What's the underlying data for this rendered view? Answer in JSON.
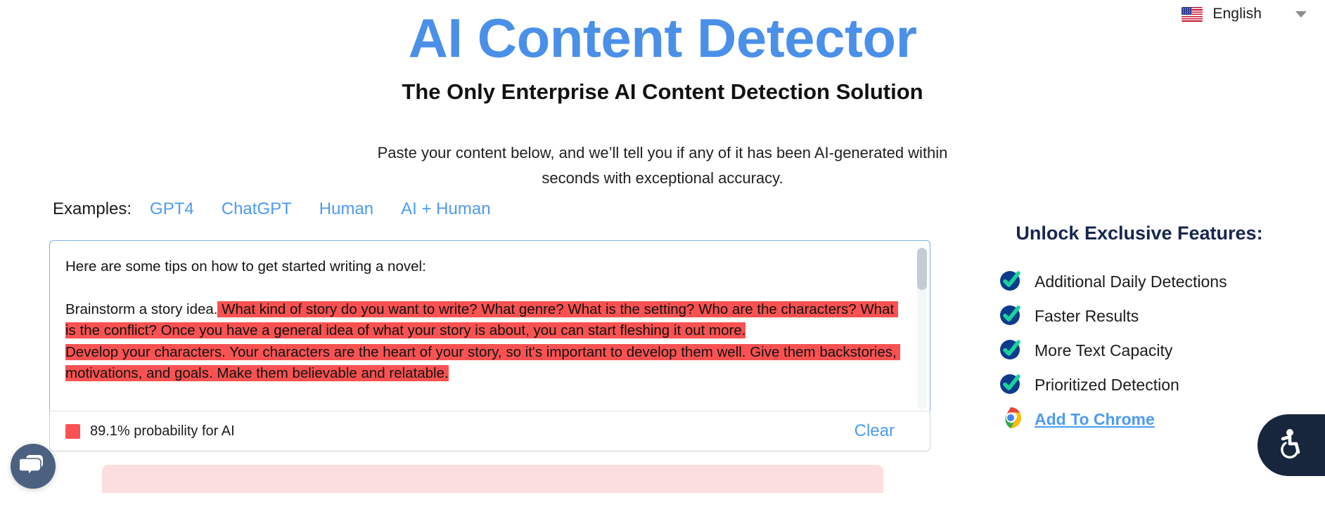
{
  "language_selector": {
    "flag_icon": "us-flag-icon",
    "label": "English",
    "caret_icon": "chevron-down-icon"
  },
  "hero": {
    "title": "AI Content Detector",
    "subtitle": "The Only Enterprise AI Content Detection Solution",
    "description": "Paste your content below, and we’ll tell you if any of it has been AI-generated within seconds with exceptional accuracy.",
    "title_color": "#4a90e8"
  },
  "examples": {
    "label": "Examples:",
    "items": [
      {
        "label": "GPT4"
      },
      {
        "label": "ChatGPT"
      },
      {
        "label": "Human"
      },
      {
        "label": "AI + Human"
      }
    ],
    "link_color": "#4e9af1"
  },
  "editor": {
    "intro_line": "Here are some tips on how to get started writing a novel:",
    "line2_plain": "Brainstorm a story idea.",
    "line2_highlight": " What kind of story do you want to write? What genre? What is the setting? Who are the characters? What is the conflict? Once you have a general idea of what your story is about, you can start fleshing it out more.",
    "line3_highlight": "Develop your characters. Your characters are the heart of your story, so it's important to develop them well. Give them backstories, motivations, and goals. Make them believable and relatable.",
    "highlight_color": "#fa5252"
  },
  "result": {
    "swatch_color": "#fa5252",
    "probability_text": "89.1% probability for AI",
    "clear_label": "Clear"
  },
  "sidebar": {
    "heading": "Unlock Exclusive Features:",
    "features": [
      {
        "icon": "check-circle-icon",
        "label": "Additional Daily Detections",
        "is_link": false
      },
      {
        "icon": "check-circle-icon",
        "label": "Faster Results",
        "is_link": false
      },
      {
        "icon": "check-circle-icon",
        "label": "More Text Capacity",
        "is_link": false
      },
      {
        "icon": "check-circle-icon",
        "label": "Prioritized Detection",
        "is_link": false
      },
      {
        "icon": "chrome-icon",
        "label": "Add To Chrome",
        "is_link": true
      }
    ],
    "check_circle_color": "#0b3b8c",
    "check_mark_color": "#19d39a",
    "heading_color": "#17264f"
  },
  "widgets": {
    "chat": {
      "icon": "chat-bubble-icon",
      "color": "#4c6180"
    },
    "accessibility": {
      "icon": "wheelchair-accessibility-icon",
      "color": "#17263c"
    }
  }
}
